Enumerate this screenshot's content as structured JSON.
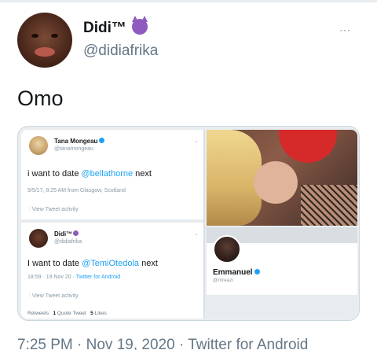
{
  "tweet": {
    "author_name": "Didi™",
    "author_handle": "@didiafrika",
    "more_icon": "⋯",
    "text": "Omo",
    "timestamp": "7:25 PM · Nov 19, 2020 · Twitter for Android"
  },
  "media": {
    "left_screenshot": {
      "tweet1": {
        "name": "Tana Mongeau",
        "handle": "@tanamongeau",
        "text_before": "i want to date ",
        "mention": "@bellathorne",
        "text_after": " next",
        "meta": "9/5/17, 8:25 AM from Glasgow, Scotland",
        "activity": "View Tweet activity"
      },
      "tweet2": {
        "name": "Didi™",
        "handle": "@didiafrika",
        "text_before": "I want to date ",
        "mention": "@TemiOtedola",
        "text_after": " next",
        "meta_time": "18:59 · 19 Nov 20 · ",
        "meta_source": "Twitter for Android",
        "activity": "View Tweet activity",
        "retweets_count": "",
        "retweets_label": "Retweets",
        "quote_count": "1",
        "quote_label": "Quote Tweet",
        "likes_count": "5",
        "likes_label": "Likes"
      }
    },
    "profile_card": {
      "name": "Emmanuel",
      "handle": "@mreazi"
    }
  },
  "colors": {
    "link": "#1da1f2",
    "secondary_text": "#657786",
    "primary_text": "#14171a"
  }
}
